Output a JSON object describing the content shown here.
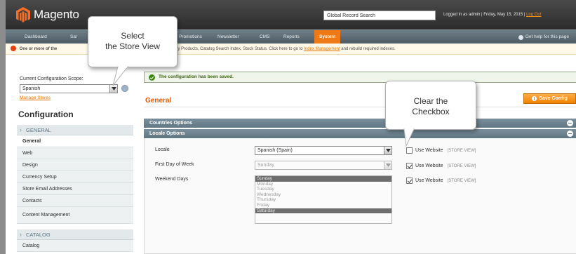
{
  "header": {
    "logo_text": "Magento",
    "global_search_value": "Global Record Search",
    "user_info": "Logged in as admin | Friday, May 15, 2015 |",
    "logout_label": "Log Out"
  },
  "nav": {
    "items": [
      "Dashboard",
      "Sal",
      "Promotions",
      "Newsletter",
      "CMS",
      "Reports",
      "System"
    ],
    "active": "System",
    "help_label": "Get help for this page"
  },
  "notice": {
    "text": "One or more of the",
    "text2": "L Rewrites, Category Products, Catalog Search Index, Stock Status. Click here to go to",
    "link": "Index Management",
    "text3": "and rebuild required indexes."
  },
  "sidebar": {
    "scope_label": "Current Configuration Scope:",
    "scope_value": "Spanish",
    "manage_stores": "Manage Stores",
    "config_title": "Configuration",
    "groups": [
      {
        "label": "GENERAL",
        "items": [
          "General",
          "Web",
          "Design",
          "Currency Setup",
          "Store Email Addresses",
          "Contacts",
          "Content Management"
        ]
      },
      {
        "label": "CATALOG",
        "items": [
          "Catalog"
        ]
      }
    ],
    "active_item": "General"
  },
  "main": {
    "success_message": "The configuration has been saved.",
    "section_title": "General",
    "save_button": "Save Config",
    "countries_options": "Countries Options",
    "locale_options": "Locale Options",
    "fields": {
      "locale": {
        "label": "Locale",
        "value": "Spanish (Spain)",
        "use_website": false
      },
      "first_day": {
        "label": "First Day of Week",
        "value": "Sunday",
        "use_website": true
      },
      "weekend": {
        "label": "Weekend Days",
        "options": [
          "Sunday",
          "Monday",
          "Tuesday",
          "Wednesday",
          "Thursday",
          "Friday",
          "Saturday"
        ],
        "selected": [
          "Sunday",
          "Saturday"
        ],
        "use_website": true
      }
    },
    "use_website_label": "Use Website",
    "scope_tag": "[STORE VIEW]"
  },
  "callouts": {
    "store": [
      "Select",
      "the Store View"
    ],
    "checkbox": [
      "Clear the",
      "Checkbox"
    ]
  },
  "colors": {
    "brand_orange": "#f18200",
    "header_dark": "#2c2c2c",
    "nav_blue_gray": "#607884",
    "success_green": "#3d8b10"
  }
}
